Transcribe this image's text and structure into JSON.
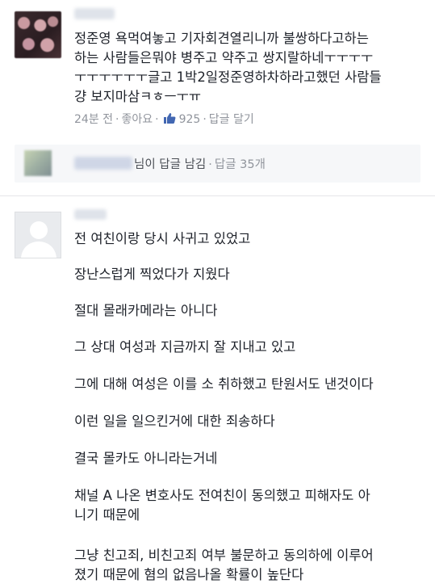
{
  "comment1": {
    "text_lines": [
      "정준영 욕먹여놓고 기자회견열리니까 불쌍하다고하는",
      "하는 사람들은뭐야  병주고 약주고 쌍지랄하네ㅜㅜㅜㅜ",
      "ㅜㅜㅜㅜㅜㅜ글고 1박2일정준영하차하라고했던 사람들",
      "걍 보지마삼ㅋㅎㅡㅜㅠ"
    ],
    "time": "24분 전",
    "like_label": "좋아요",
    "like_count": "925",
    "reply_label": "답글 달기"
  },
  "reply_summary": {
    "name_suffix": "님",
    "action": "이 답글 남김",
    "count": "답글 35개"
  },
  "comment2": {
    "lines": [
      "전 여친이랑 당시 사귀고 있었고",
      "장난스럽게 찍었다가 지웠다",
      "절대 몰래카메라는 아니다",
      "그 상대 여성과 지금까지 잘 지내고 있고",
      "그에 대해 여성은 이를 소 취하했고 탄원서도 낸것이다",
      "이런 일을 일으킨거에 대한 죄송하다",
      "결국 몰카도 아니라는거네",
      "채널 A 나온 변호사도 전여친이 동의했고 피해자도 아",
      "니기 때문에",
      "그냥 친고죄, 비친고죄 여부 불문하고 동의하에 이루어",
      "졌기 때문에 혐의 없음나올 확률이 높단다"
    ]
  },
  "colors": {
    "text": "#1d2129",
    "meta": "#90949c",
    "like_blue": "#4267b2",
    "reply_bg": "#f6f7f9"
  }
}
